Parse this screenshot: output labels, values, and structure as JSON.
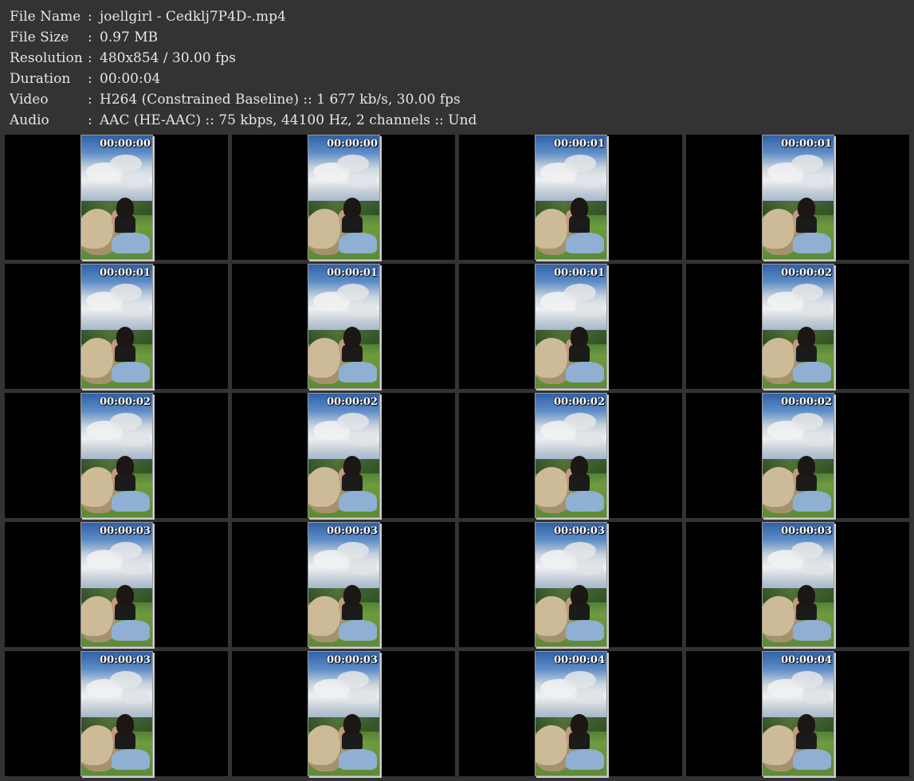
{
  "info": [
    {
      "label": "File Name",
      "sep": ":",
      "value": "joellgirl - Cedklj7P4D-.mp4"
    },
    {
      "label": "File Size",
      "sep": ":",
      "value": "0.97 MB"
    },
    {
      "label": "Resolution",
      "sep": ":",
      "value": "480x854 / 30.00 fps"
    },
    {
      "label": "Duration",
      "sep": ":",
      "value": "00:00:04"
    },
    {
      "label": "Video",
      "sep": ":",
      "value": "H264 (Constrained Baseline) :: 1 677 kb/s, 30.00 fps"
    },
    {
      "label": "Audio",
      "sep": ":",
      "value": "AAC (HE-AAC) :: 75 kbps, 44100 Hz, 2 channels :: Und"
    }
  ],
  "thumbnails": [
    {
      "timestamp": "00:00:00"
    },
    {
      "timestamp": "00:00:00"
    },
    {
      "timestamp": "00:00:01"
    },
    {
      "timestamp": "00:00:01"
    },
    {
      "timestamp": "00:00:01"
    },
    {
      "timestamp": "00:00:01"
    },
    {
      "timestamp": "00:00:01"
    },
    {
      "timestamp": "00:00:02"
    },
    {
      "timestamp": "00:00:02"
    },
    {
      "timestamp": "00:00:02"
    },
    {
      "timestamp": "00:00:02"
    },
    {
      "timestamp": "00:00:02"
    },
    {
      "timestamp": "00:00:03"
    },
    {
      "timestamp": "00:00:03"
    },
    {
      "timestamp": "00:00:03"
    },
    {
      "timestamp": "00:00:03"
    },
    {
      "timestamp": "00:00:03"
    },
    {
      "timestamp": "00:00:03"
    },
    {
      "timestamp": "00:00:04"
    },
    {
      "timestamp": "00:00:04"
    }
  ]
}
